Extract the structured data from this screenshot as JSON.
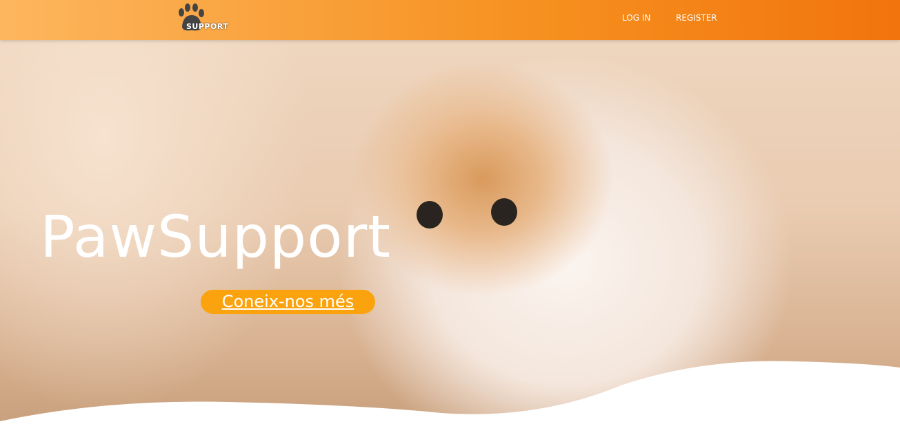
{
  "nav": {
    "logo_text": "SUPPORT",
    "login": "LOG IN",
    "register": "REGISTER"
  },
  "hero": {
    "title": "PawSupport",
    "cta": "Coneix-nos més"
  }
}
